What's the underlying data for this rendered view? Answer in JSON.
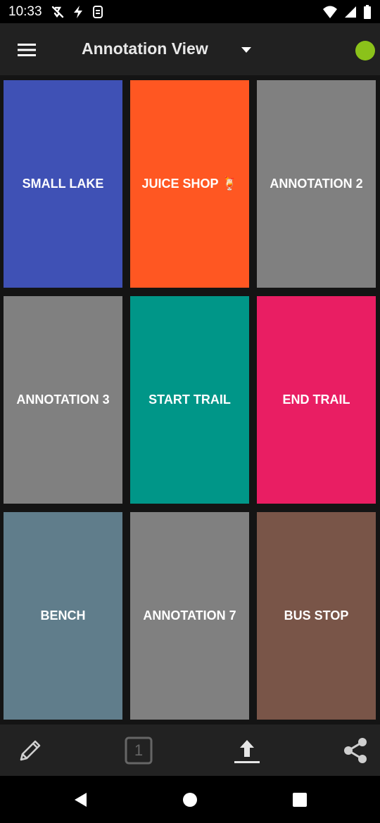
{
  "status_bar": {
    "time": "10:33"
  },
  "app_bar": {
    "title": "Annotation View",
    "menu_icon": "hamburger-menu-icon",
    "dropdown_icon": "dropdown-arrow-icon",
    "status_dot_color": "#8bc21a"
  },
  "tiles": [
    {
      "label": "SMALL LAKE",
      "color": "#3f51b5"
    },
    {
      "label": "JUICE SHOP 🍹",
      "color": "#ff5722"
    },
    {
      "label": "ANNOTATION 2",
      "color": "#808080"
    },
    {
      "label": "ANNOTATION 3",
      "color": "#808080"
    },
    {
      "label": "START TRAIL",
      "color": "#009688"
    },
    {
      "label": "END TRAIL",
      "color": "#e91e63"
    },
    {
      "label": "BENCH",
      "color": "#607d8b"
    },
    {
      "label": "ANNOTATION 7",
      "color": "#808080"
    },
    {
      "label": "BUS STOP",
      "color": "#795548"
    }
  ],
  "bottom_bar": {
    "page_number": "1",
    "icons": [
      "pencil-icon",
      "page-number-icon",
      "upload-icon",
      "share-icon"
    ]
  },
  "nav_bar": {
    "icons": [
      "back-icon",
      "home-icon",
      "recents-icon"
    ]
  }
}
